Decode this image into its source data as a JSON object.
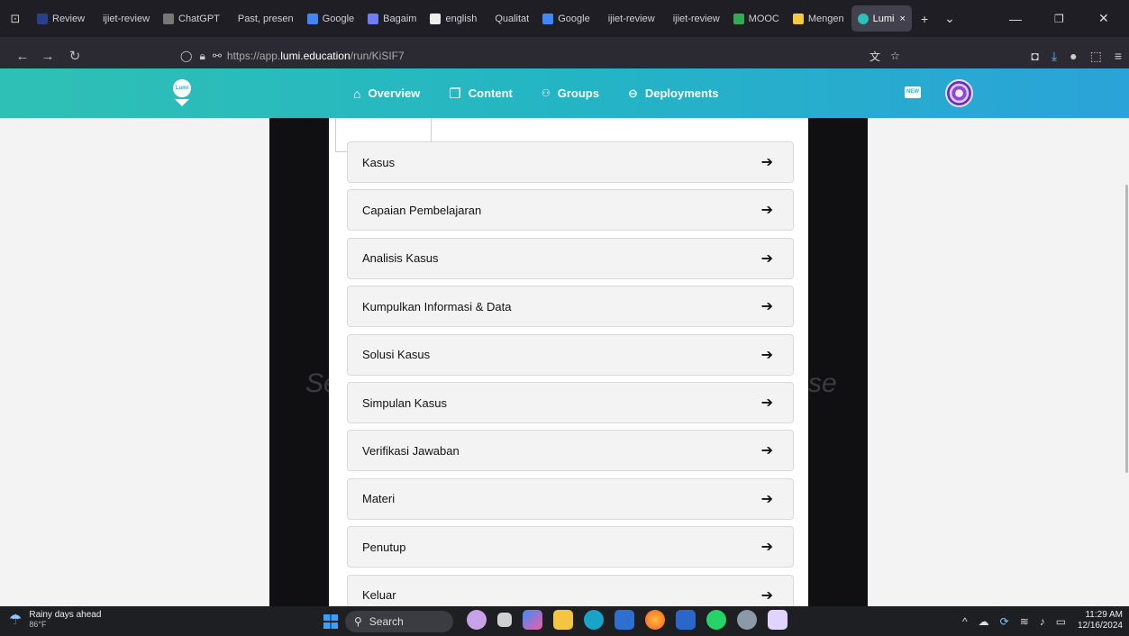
{
  "browser": {
    "tabs": [
      {
        "label": "Review",
        "color": "#2b3f8f"
      },
      {
        "label": "ijiet-review",
        "color": ""
      },
      {
        "label": "ChatGPT",
        "color": "#777"
      },
      {
        "label": "Past, presen",
        "color": ""
      },
      {
        "label": "Google",
        "color": "#4285f4"
      },
      {
        "label": "Bagaim",
        "color": "#6f7cf5"
      },
      {
        "label": "english",
        "color": "#eee"
      },
      {
        "label": "Qualitat",
        "color": ""
      },
      {
        "label": "Google",
        "color": "#4285f4"
      },
      {
        "label": "ijiet-review",
        "color": ""
      },
      {
        "label": "ijiet-review",
        "color": ""
      },
      {
        "label": "MOOC",
        "color": "#34a853"
      },
      {
        "label": "Mengen",
        "color": "#f5c842"
      }
    ],
    "active_tab": {
      "label": "Lumi",
      "close": "×",
      "color": "#2ec0b8"
    },
    "new_tab": "+",
    "tab_list": "⌄",
    "url_prefix": "https://app.",
    "url_host": "lumi.education",
    "url_path": "/run/KiSIF7"
  },
  "app": {
    "logo_text": "Lumi",
    "nav": [
      {
        "label": "Overview",
        "icon": "home-icon"
      },
      {
        "label": "Content",
        "icon": "copy-icon"
      },
      {
        "label": "Groups",
        "icon": "groups-icon"
      },
      {
        "label": "Deployments",
        "icon": "link-icon"
      }
    ],
    "new_badge": "NEW"
  },
  "background_text": {
    "left": "Se",
    "right": "se"
  },
  "menu": [
    {
      "label": "Kasus"
    },
    {
      "label": "Capaian Pembelajaran"
    },
    {
      "label": "Analisis Kasus"
    },
    {
      "label": "Kumpulkan Informasi & Data"
    },
    {
      "label": "Solusi Kasus"
    },
    {
      "label": "Simpulan Kasus"
    },
    {
      "label": "Verifikasi Jawaban"
    },
    {
      "label": "Materi"
    },
    {
      "label": "Penutup"
    },
    {
      "label": "Keluar"
    }
  ],
  "taskbar": {
    "weather_title": "Rainy days ahead",
    "weather_temp": "86°F",
    "search_label": "Search",
    "time": "11:29 AM",
    "date": "12/16/2024"
  }
}
